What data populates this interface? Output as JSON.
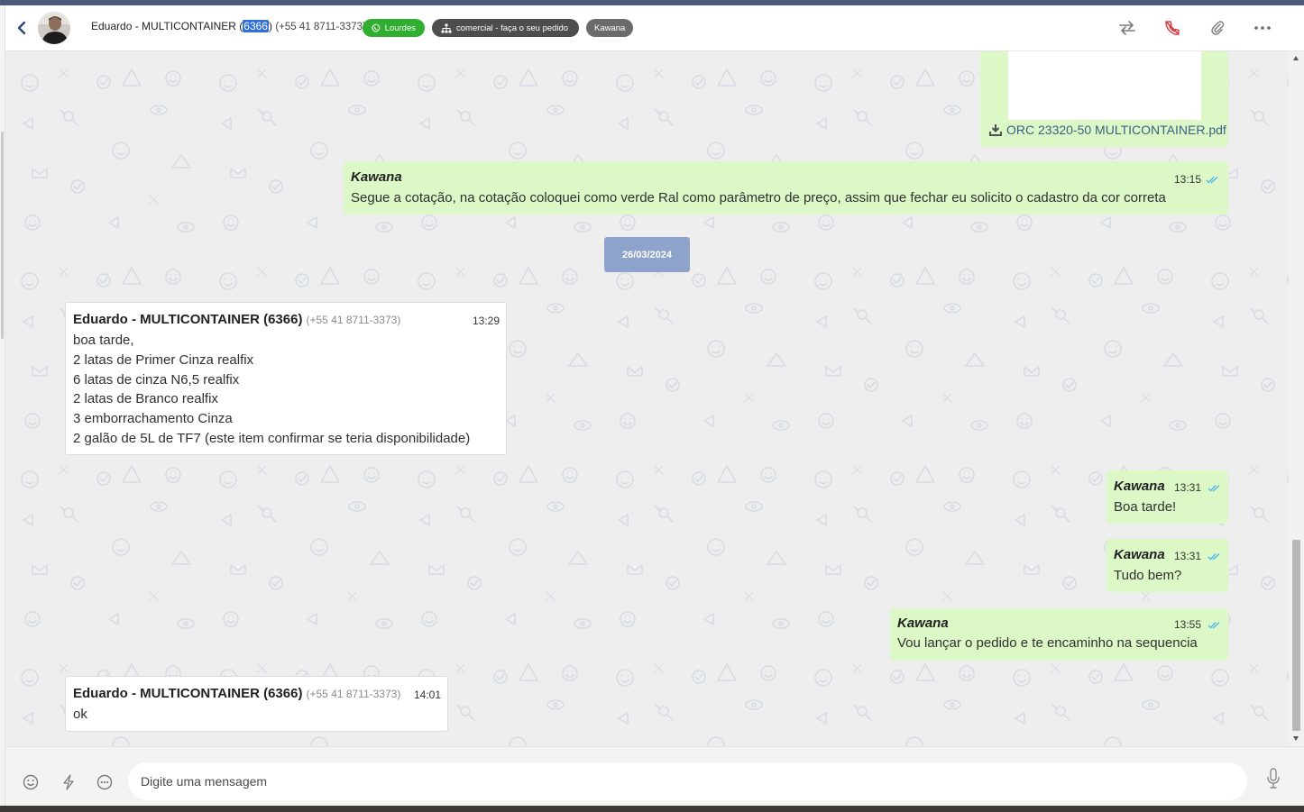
{
  "header": {
    "contact_name_prefix": "Eduardo - MULTICONTAINER ",
    "contact_id": "6366",
    "contact_phone": "(+55 41 8711-3373)",
    "tags": [
      {
        "label": "Lourdes",
        "icon": "whatsapp-icon",
        "color": "#2fae2f"
      },
      {
        "label": "comercial - faça o seu pedido",
        "icon": "sitemap-icon",
        "color": "#4d4d4d"
      },
      {
        "label": "Kawana",
        "color": "#6b6b6b"
      }
    ],
    "icons": [
      "transfer-icon",
      "end-call-icon",
      "attach-icon",
      "more-icon"
    ]
  },
  "messages": {
    "pdf": {
      "file_name": "ORC 23320-50 MULTICONTAINER.pdf"
    },
    "m1": {
      "sender": "Kawana",
      "time": "13:15",
      "text": "Segue a cotação, na cotação coloquei como verde Ral como parâmetro de preço, assim que fechar eu solicito o cadastro da cor correta"
    },
    "date_separator": "26/03/2024",
    "m2": {
      "sender": "Eduardo - MULTICONTAINER (6366)",
      "phone": "(+55 41 8711-3373)",
      "time": "13:29",
      "lines": [
        "boa tarde,",
        "2 latas de Primer Cinza realfix",
        "6 latas de cinza N6,5 realfix",
        "2 latas de Branco realfix",
        "3 emborrachamento Cinza",
        "2 galão de 5L de TF7 (este item confirmar se teria disponibilidade)"
      ]
    },
    "m3": {
      "sender": "Kawana",
      "time": "13:31",
      "text": "Boa tarde!"
    },
    "m4": {
      "sender": "Kawana",
      "time": "13:31",
      "text": "Tudo bem?"
    },
    "m5": {
      "sender": "Kawana",
      "time": "13:55",
      "text": "Vou lançar o pedido e te encaminho na sequencia"
    },
    "m6": {
      "sender": "Eduardo - MULTICONTAINER (6366)",
      "phone": "(+55 41 8711-3373)",
      "time": "14:01",
      "text": "ok"
    }
  },
  "composer": {
    "placeholder": "Digite uma mensagem",
    "icons": [
      "emoji-icon",
      "quick-reply-icon",
      "chat-options-icon",
      "microphone-icon"
    ]
  },
  "colors": {
    "outgoing_bubble": "#dcf8c6",
    "incoming_bubble": "#ffffff",
    "chat_background": "#eeeeee",
    "date_chip": "#8ea3cc",
    "read_ticks": "#4fb6ec",
    "end_call": "#d9363e"
  }
}
